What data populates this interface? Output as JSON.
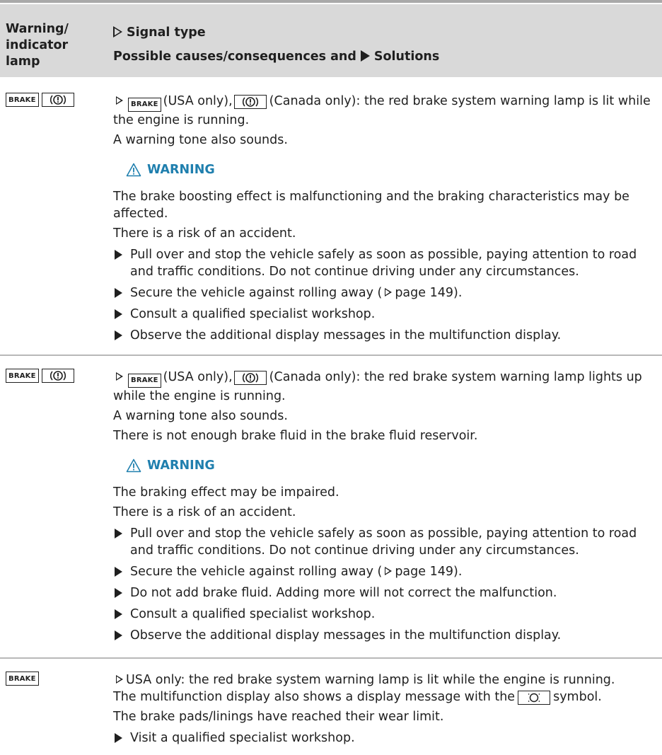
{
  "header": {
    "col1_label": "Warning/ indicator lamp",
    "col2_line1": "Signal type",
    "col2_line2_a": "Possible causes/consequences and",
    "col2_line2_b": "Solutions"
  },
  "icons": {
    "brake_text": "BRAKE",
    "tri_open": "open-triangle-icon",
    "tri_solid": "solid-triangle-icon",
    "warning_icon": "warning-triangle-icon",
    "circle_exclaim": "brake-circle-exclamation-icon",
    "brake_pad_icon": "brake-pad-wear-icon"
  },
  "colors": {
    "warning": "#1f7fae",
    "header_bg": "#d9d9d9"
  },
  "rows": [
    {
      "signal_a": "(USA only),",
      "signal_b": "(Canada only): the red brake system warning lamp is lit while the engine is running.",
      "tone": "A warning tone also sounds.",
      "warning_label": "WARNING",
      "warn_text": "The brake boosting effect is malfunctioning and the braking characteristics may be affected.",
      "risk": "There is a risk of an accident.",
      "steps": [
        "Pull over and stop the vehicle safely as soon as possible, paying attention to road and traffic conditions. Do not continue driving under any circumstances.",
        "Secure the vehicle against rolling away (",
        "Consult a qualified specialist workshop.",
        "Observe the additional display messages in the multifunction display."
      ],
      "page_ref": "page 149)."
    },
    {
      "signal_a": "(USA only),",
      "signal_b": "(Canada only): the red brake system warning lamp lights up while the engine is running.",
      "tone": "A warning tone also sounds.",
      "fluid": "There is not enough brake fluid in the brake fluid reservoir.",
      "warning_label": "WARNING",
      "warn_text": "The braking effect may be impaired.",
      "risk": "There is a risk of an accident.",
      "steps": [
        "Pull over and stop the vehicle safely as soon as possible, paying attention to road and traffic conditions. Do not continue driving under any circumstances.",
        "Secure the vehicle against rolling away (",
        "Do not add brake fluid. Adding more will not correct the malfunction.",
        "Consult a qualified specialist workshop.",
        "Observe the additional display messages in the multifunction display."
      ],
      "page_ref": "page 149)."
    },
    {
      "signal": "USA only: the red brake system warning lamp is lit while the engine is running.",
      "display_a": "The multifunction display also shows a display message with the",
      "display_b": "symbol.",
      "pads": "The brake pads/linings have reached their wear limit.",
      "step": "Visit a qualified specialist workshop."
    }
  ]
}
